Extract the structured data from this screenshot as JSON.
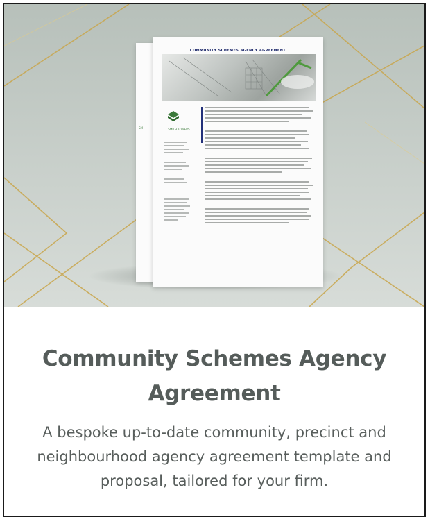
{
  "card": {
    "document_heading": "COMMUNITY SCHEMES AGENCY AGREEMENT",
    "document_logo_text": "SMITH TOWERS",
    "title": "Community Schemes Agency Agreement",
    "description": "A bespoke up-to-date community, precinct and neighbourhood agency agreement template and proposal, tailored for your firm."
  },
  "colors": {
    "background": "#c4ccc7",
    "gold_lines": "#c9a64c",
    "title_text": "#555c5a",
    "body_text": "#585e5c",
    "logo_green": "#3b7a3a",
    "doc_heading_blue": "#1f2a6b"
  }
}
